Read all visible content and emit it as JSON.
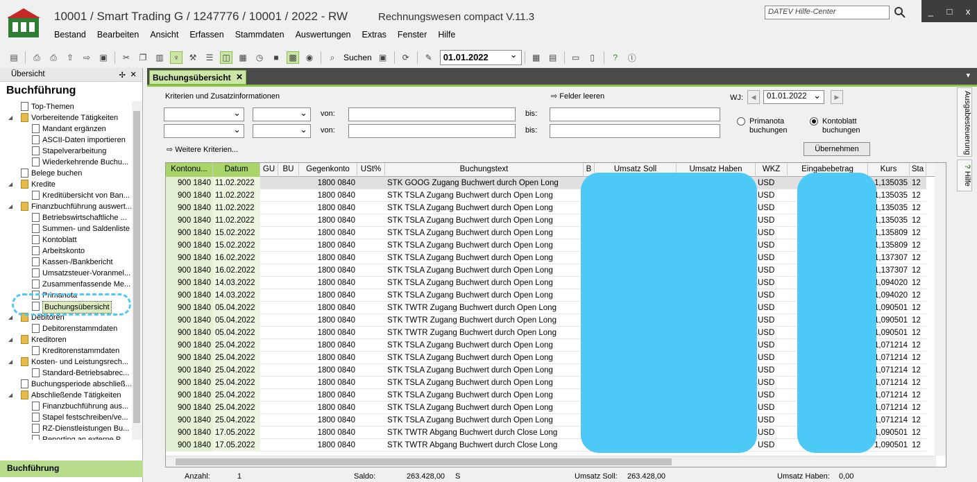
{
  "window": {
    "title": "10001 / Smart Trading G / 1247776 / 10001 / 2022 - RW",
    "app_name": "Rechnungswesen compact V.11.3",
    "help_placeholder": "DATEV Hilfe-Center",
    "controls": [
      "_",
      "□",
      "x"
    ]
  },
  "menu": [
    "Bestand",
    "Bearbeiten",
    "Ansicht",
    "Erfassen",
    "Stammdaten",
    "Auswertungen",
    "Extras",
    "Fenster",
    "Hilfe"
  ],
  "toolbar": {
    "search_label": "Suchen",
    "date": "01.01.2022"
  },
  "left_panel": {
    "header": "Übersicht",
    "title": "Buchführung",
    "bottom": "Buchführung",
    "tree": [
      {
        "label": "Top-Themen",
        "level": 0,
        "kind": "doc"
      },
      {
        "label": "Vorbereitende Tätigkeiten",
        "level": 0,
        "kind": "folder",
        "exp": true
      },
      {
        "label": "Mandant ergänzen",
        "level": 1,
        "kind": "doc"
      },
      {
        "label": "ASCII-Daten importieren",
        "level": 1,
        "kind": "doc"
      },
      {
        "label": "Stapelverarbeitung",
        "level": 1,
        "kind": "doc"
      },
      {
        "label": "Wiederkehrende Buchu...",
        "level": 1,
        "kind": "doc"
      },
      {
        "label": "Belege buchen",
        "level": 0,
        "kind": "doc"
      },
      {
        "label": "Kredite",
        "level": 0,
        "kind": "folder",
        "exp": true
      },
      {
        "label": "Kreditübersicht von Ban...",
        "level": 1,
        "kind": "doc"
      },
      {
        "label": "Finanzbuchführung auswert...",
        "level": 0,
        "kind": "folder",
        "exp": true
      },
      {
        "label": "Betriebswirtschaftliche ...",
        "level": 1,
        "kind": "doc"
      },
      {
        "label": "Summen- und Saldenliste",
        "level": 1,
        "kind": "doc"
      },
      {
        "label": "Kontoblatt",
        "level": 1,
        "kind": "doc"
      },
      {
        "label": "Arbeitskonto",
        "level": 1,
        "kind": "doc"
      },
      {
        "label": "Kassen-/Bankbericht",
        "level": 1,
        "kind": "doc"
      },
      {
        "label": "Umsatzsteuer-Voranmel...",
        "level": 1,
        "kind": "doc"
      },
      {
        "label": "Zusammenfassende Me...",
        "level": 1,
        "kind": "doc"
      },
      {
        "label": "Primanota",
        "level": 1,
        "kind": "doc"
      },
      {
        "label": "Buchungsübersicht",
        "level": 1,
        "kind": "doc",
        "selected": true
      },
      {
        "label": "Debitoren",
        "level": 0,
        "kind": "folder",
        "exp": true
      },
      {
        "label": "Debitorenstammdaten",
        "level": 1,
        "kind": "doc"
      },
      {
        "label": "Kreditoren",
        "level": 0,
        "kind": "folder",
        "exp": true
      },
      {
        "label": "Kreditorenstammdaten",
        "level": 1,
        "kind": "doc"
      },
      {
        "label": "Kosten- und Leistungsrech...",
        "level": 0,
        "kind": "folder",
        "exp": true
      },
      {
        "label": "Standard-Betriebsabrec...",
        "level": 1,
        "kind": "doc"
      },
      {
        "label": "Buchungsperiode abschließ...",
        "level": 0,
        "kind": "doc"
      },
      {
        "label": "Abschließende Tätigkeiten",
        "level": 0,
        "kind": "folder",
        "exp": true
      },
      {
        "label": "Finanzbuchführung aus...",
        "level": 1,
        "kind": "doc"
      },
      {
        "label": "Stapel festschreiben/ve...",
        "level": 1,
        "kind": "doc"
      },
      {
        "label": "RZ-Dienstleistungen Bu...",
        "level": 1,
        "kind": "doc"
      },
      {
        "label": "Reporting an externe P...",
        "level": 1,
        "kind": "doc"
      }
    ]
  },
  "tab": {
    "label": "Buchungsübersicht",
    "close": "✕"
  },
  "filters": {
    "criteria_label": "Kriterien und Zusatzinformationen",
    "clear_label": "Felder leeren",
    "from_label": "von:",
    "to_label": "bis:",
    "more_label": "Weitere Kriterien...",
    "wj_label": "WJ:",
    "wj_value": "01.01.2022",
    "radio1": "Primanota buchungen",
    "radio2": "Kontoblatt buchungen",
    "apply_label": "Übernehmen"
  },
  "grid": {
    "columns": [
      "Kontonu...",
      "Datum",
      "GU",
      "BU",
      "Gegenkonto",
      "USt%",
      "Buchungstext",
      "B",
      "Umsatz Soll",
      "Umsatz Haben",
      "WKZ",
      "Eingabebetrag",
      "Kurs",
      "Sta"
    ],
    "rows": [
      [
        "900 1840",
        "11.02.2022",
        "1800 0840",
        "STK GOOG Zugang Buchwert durch Open Long",
        "USD",
        "1,135035",
        "12"
      ],
      [
        "900 1840",
        "11.02.2022",
        "1800 0840",
        "STK TSLA Zugang Buchwert durch Open Long",
        "USD",
        "1,135035",
        "12"
      ],
      [
        "900 1840",
        "11.02.2022",
        "1800 0840",
        "STK TSLA Zugang Buchwert durch Open Long",
        "USD",
        "1,135035",
        "12"
      ],
      [
        "900 1840",
        "11.02.2022",
        "1800 0840",
        "STK TSLA Zugang Buchwert durch Open Long",
        "USD",
        "1,135035",
        "12"
      ],
      [
        "900 1840",
        "15.02.2022",
        "1800 0840",
        "STK TSLA Zugang Buchwert durch Open Long",
        "USD",
        "1,135809",
        "12"
      ],
      [
        "900 1840",
        "15.02.2022",
        "1800 0840",
        "STK TSLA Zugang Buchwert durch Open Long",
        "USD",
        "1,135809",
        "12"
      ],
      [
        "900 1840",
        "16.02.2022",
        "1800 0840",
        "STK TSLA Zugang Buchwert durch Open Long",
        "USD",
        "1,137307",
        "12"
      ],
      [
        "900 1840",
        "16.02.2022",
        "1800 0840",
        "STK TSLA Zugang Buchwert durch Open Long",
        "USD",
        "1,137307",
        "12"
      ],
      [
        "900 1840",
        "14.03.2022",
        "1800 0840",
        "STK TSLA Zugang Buchwert durch Open Long",
        "USD",
        "1,094020",
        "12"
      ],
      [
        "900 1840",
        "14.03.2022",
        "1800 0840",
        "STK TSLA Zugang Buchwert durch Open Long",
        "USD",
        "1,094020",
        "12"
      ],
      [
        "900 1840",
        "05.04.2022",
        "1800 0840",
        "STK TWTR Zugang Buchwert durch Open Long",
        "USD",
        "1,090501",
        "12"
      ],
      [
        "900 1840",
        "05.04.2022",
        "1800 0840",
        "STK TWTR Zugang Buchwert durch Open Long",
        "USD",
        "1,090501",
        "12"
      ],
      [
        "900 1840",
        "05.04.2022",
        "1800 0840",
        "STK TWTR Zugang Buchwert durch Open Long",
        "USD",
        "1,090501",
        "12"
      ],
      [
        "900 1840",
        "25.04.2022",
        "1800 0840",
        "STK TSLA Zugang Buchwert durch Open Long",
        "USD",
        "1,071214",
        "12"
      ],
      [
        "900 1840",
        "25.04.2022",
        "1800 0840",
        "STK TSLA Zugang Buchwert durch Open Long",
        "USD",
        "1,071214",
        "12"
      ],
      [
        "900 1840",
        "25.04.2022",
        "1800 0840",
        "STK TSLA Zugang Buchwert durch Open Long",
        "USD",
        "1,071214",
        "12"
      ],
      [
        "900 1840",
        "25.04.2022",
        "1800 0840",
        "STK TSLA Zugang Buchwert durch Open Long",
        "USD",
        "1,071214",
        "12"
      ],
      [
        "900 1840",
        "25.04.2022",
        "1800 0840",
        "STK TSLA Zugang Buchwert durch Open Long",
        "USD",
        "1,071214",
        "12"
      ],
      [
        "900 1840",
        "25.04.2022",
        "1800 0840",
        "STK TSLA Zugang Buchwert durch Open Long",
        "USD",
        "1,071214",
        "12"
      ],
      [
        "900 1840",
        "25.04.2022",
        "1800 0840",
        "STK TSLA Zugang Buchwert durch Open Long",
        "USD",
        "1,071214",
        "12"
      ],
      [
        "900 1840",
        "17.05.2022",
        "1800 0840",
        "STK TWTR Abgang Buchwert durch Close Long",
        "USD",
        "1,090501",
        "12"
      ],
      [
        "900 1840",
        "17.05.2022",
        "1800 0840",
        "STK TWTR Abgang Buchwert durch Close Long",
        "USD",
        "1,090501",
        "12"
      ]
    ]
  },
  "status": {
    "count_label": "Anzahl:",
    "count": "1",
    "saldo_label": "Saldo:",
    "saldo": "263.428,00",
    "saldo_side": "S",
    "soll_label": "Umsatz Soll:",
    "soll": "263.428,00",
    "haben_label": "Umsatz Haben:",
    "haben": "0,00"
  },
  "side_tabs": [
    "Ausgabesteuerung",
    "Hilfe"
  ],
  "colors": {
    "accent_green": "#a8d468",
    "redaction": "#4dc9f7",
    "tab_bar": "#4a4a4a"
  }
}
